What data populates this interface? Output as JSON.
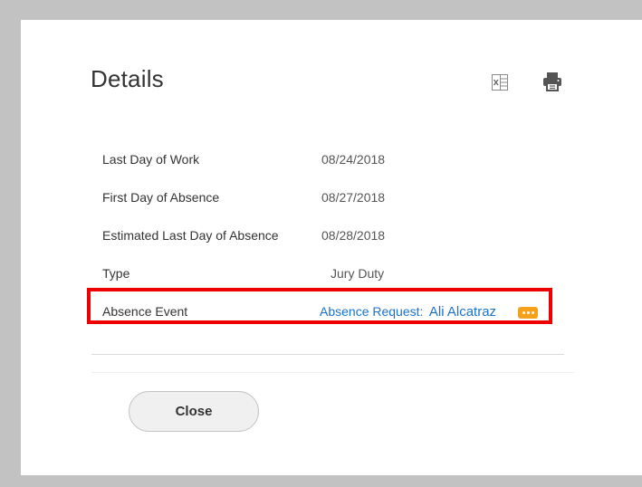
{
  "dialog": {
    "title": "Details",
    "toolbar": {
      "export_icon": "excel-export-icon",
      "print_icon": "print-icon"
    },
    "rows": [
      {
        "label": "Last Day of Work",
        "value": "08/24/2018"
      },
      {
        "label": "First Day of Absence",
        "value": "08/27/2018"
      },
      {
        "label": "Estimated Last Day of Absence",
        "value": "08/28/2018"
      },
      {
        "label": "Type",
        "value": "Jury Duty"
      }
    ],
    "absence_event": {
      "label": "Absence Event",
      "link_prefix": "Absence Request:",
      "link_person": "Ali Alcatraz",
      "more_icon": "related-actions-icon"
    },
    "close_label": "Close"
  },
  "colors": {
    "backdrop": "#c2c2c2",
    "link": "#1a73c7",
    "highlight": "#ee0000",
    "related_actions": "#f5a11c"
  }
}
